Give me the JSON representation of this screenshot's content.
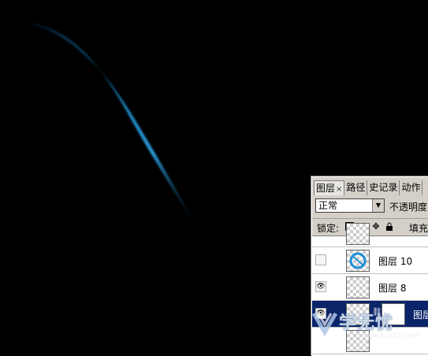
{
  "panel": {
    "tabs": [
      {
        "label": "图层",
        "close": "×",
        "active": true
      },
      {
        "label": "路径",
        "active": false
      },
      {
        "label": "史记录",
        "active": false
      },
      {
        "label": "动作",
        "active": false
      }
    ],
    "blend_mode": "正常",
    "opacity_label": "不透明度",
    "lock_label": "锁定:",
    "fill_label": "填充",
    "lock_icons": [
      "lock-transparent-icon",
      "brush-icon",
      "move-icon",
      "lock-icon"
    ]
  },
  "layers": [
    {
      "name": "",
      "visible": false
    },
    {
      "name": "图层 10",
      "visible": false
    },
    {
      "name": "图层 8",
      "visible": true
    },
    {
      "name": "图层",
      "visible": true,
      "selected": true
    }
  ],
  "watermark": {
    "text": "学无忧",
    "url": "www.xue51.com"
  },
  "colors": {
    "canvas_bg": "#000000",
    "stroke_accent": "#1e8fd6",
    "selection": "#0a246a"
  }
}
